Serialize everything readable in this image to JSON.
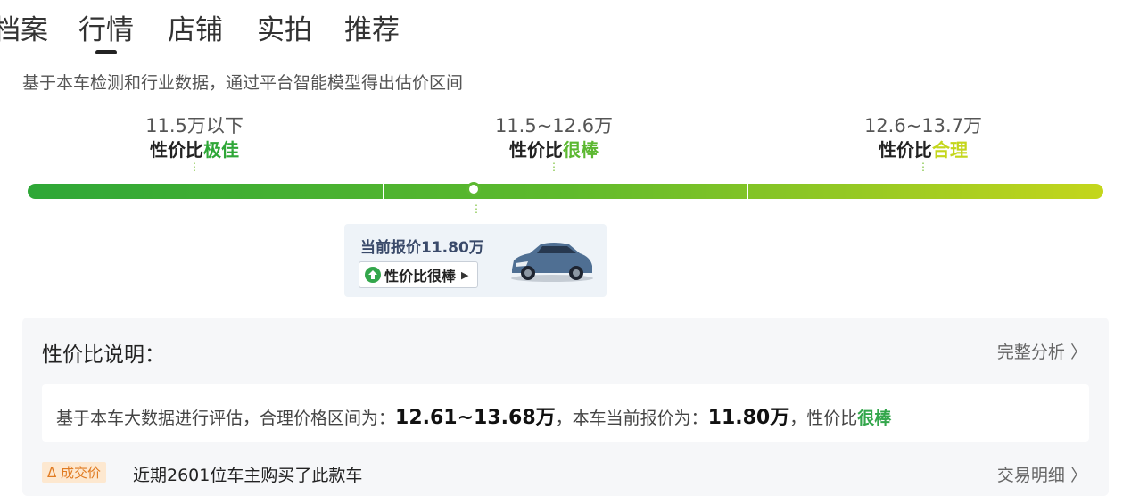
{
  "tabs": [
    "档案",
    "行情",
    "店铺",
    "实拍",
    "推荐"
  ],
  "active_tab": "行情",
  "description": "基于本车检测和行业数据，通过平台智能模型得出估价区间",
  "segments": [
    {
      "range": "11.5万以下",
      "prefix": "性价比",
      "rating": "极佳",
      "color": "#2ea737"
    },
    {
      "range": "11.5~12.6万",
      "prefix": "性价比",
      "rating": "很棒",
      "color": "#5cb831"
    },
    {
      "range": "12.6~13.7万",
      "prefix": "性价比",
      "rating": "合理",
      "color": "#b5cf1f"
    }
  ],
  "current_price": {
    "label": "当前报价11.80万",
    "rating_label": "性价比很棒"
  },
  "panel": {
    "title": "性价比说明：",
    "full_analysis": "完整分析",
    "detail_prefix": "基于本车大数据进行评估，合理价格区间为：",
    "fair_range": "12.61~13.68万",
    "detail_middle": "，本车当前报价为：",
    "price": "11.80万",
    "detail_suffix": "，性价比",
    "rating": "很棒",
    "rating_color": "#33a64b",
    "deal_badge": "成交价",
    "deal_text": "近期2601位车主购买了此款车",
    "deal_link": "交易明细"
  },
  "icons": [
    "up-arrow-icon",
    "triangle-right-icon",
    "car-image",
    "chevron-right-icon",
    "deal-icon"
  ]
}
